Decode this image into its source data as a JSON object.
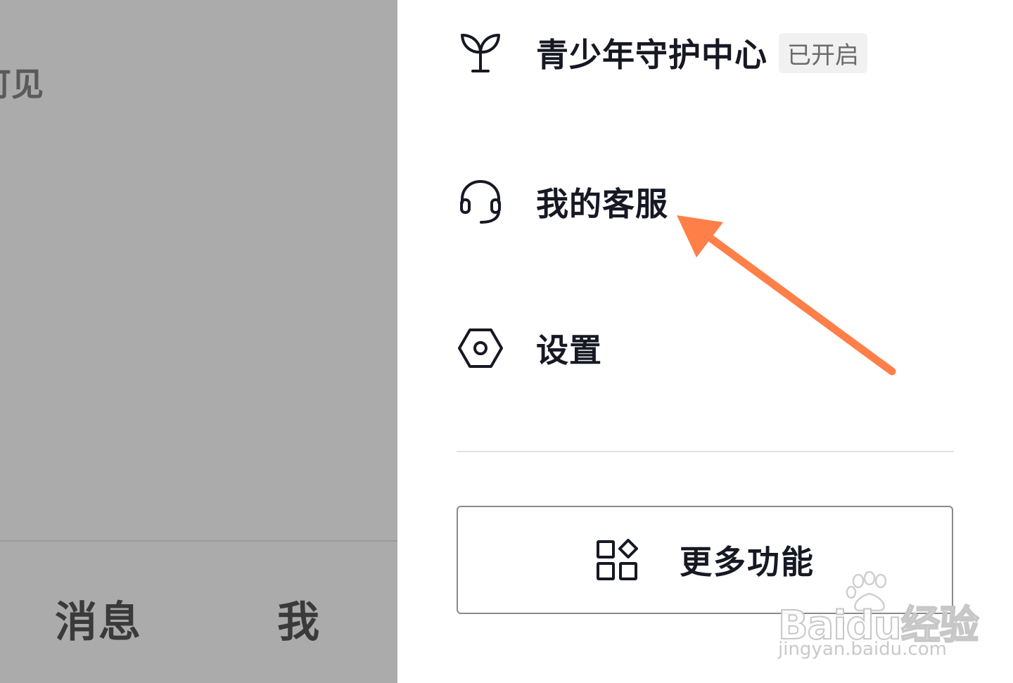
{
  "background": {
    "partial_text": "可见",
    "tabs": [
      "消息",
      "我"
    ]
  },
  "drawer": {
    "items": [
      {
        "label": "青少年守护中心",
        "badge": "已开启",
        "icon": "sprout-icon"
      },
      {
        "label": "我的客服",
        "icon": "headset-icon"
      },
      {
        "label": "设置",
        "icon": "hexagon-gear-icon"
      }
    ],
    "more_button": {
      "label": "更多功能",
      "icon": "apps-grid-icon"
    }
  },
  "watermark": {
    "text": "Baidu经验",
    "url": "jingyan.baidu.com"
  },
  "colors": {
    "annotation_arrow": "#ff7f48",
    "overlay": "#ababab",
    "text": "#161823"
  }
}
